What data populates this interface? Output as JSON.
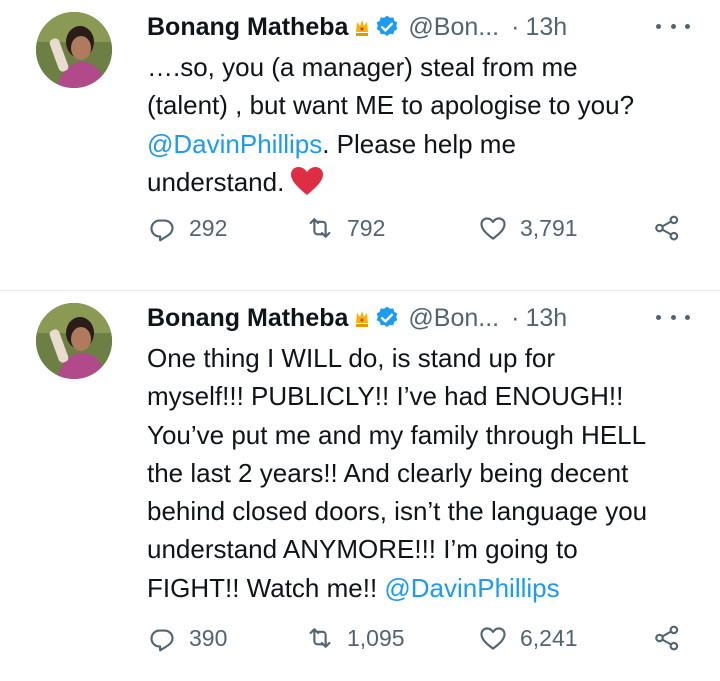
{
  "tweets": [
    {
      "author": "Bonang Matheba",
      "handle": "@Bon...",
      "separator": "·",
      "time": "13h",
      "text_before": "….so, you (a manager) steal from me\n(talent) , but want ME to apologise to you?\n",
      "mention": "@DavinPhillips",
      "text_after": ". Please help me\nunderstand.",
      "emoji": "red-heart",
      "replies": "292",
      "retweets": "792",
      "likes": "3,791"
    },
    {
      "author": "Bonang Matheba",
      "handle": "@Bon...",
      "separator": "·",
      "time": "13h",
      "text_before": "One thing I WILL do, is stand up for\nmyself!!! PUBLICLY!! I’ve had ENOUGH!!\nYou’ve put me and my family through HELL\nthe last 2 years!! And clearly being decent\nbehind closed doors, isn’t the language you\nunderstand ANYMORE!!! I’m going to\nFIGHT!! Watch me!! ",
      "mention": "@DavinPhillips",
      "text_after": "",
      "replies": "390",
      "retweets": "1,095",
      "likes": "6,241"
    }
  ],
  "colors": {
    "text": "#0f1419",
    "secondary": "#536471",
    "link": "#1d9bf0",
    "verified": "#1d9bf0",
    "heart": "#e0245e",
    "divider": "#e6ecf0"
  },
  "icons": {
    "reply": "reply-icon",
    "retweet": "retweet-icon",
    "like": "like-icon",
    "share": "share-icon",
    "verified": "verified-badge-icon",
    "crown": "crown-emoji-icon",
    "more": "more-options-icon"
  }
}
